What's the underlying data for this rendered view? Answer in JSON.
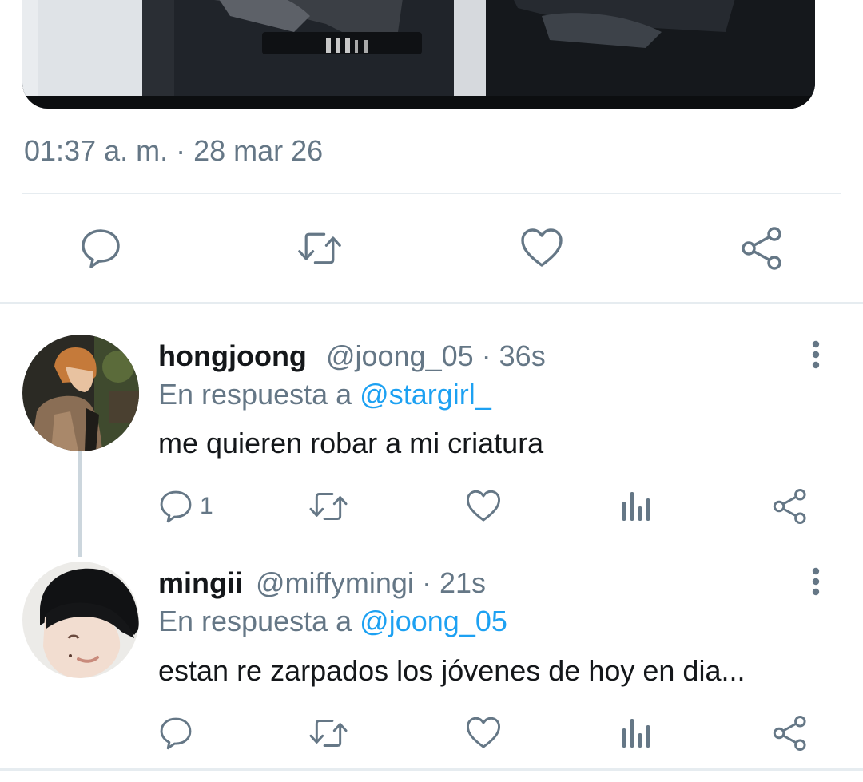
{
  "colors": {
    "text_primary": "#14171a",
    "text_secondary": "#657786",
    "link": "#1da1f2",
    "icon": "#657786",
    "divider": "#e6ecf0",
    "thread_line": "#ccd6dd"
  },
  "tweet": {
    "media": "photo",
    "timestamp": "01:37 a. m. · 28 mar 26",
    "actions": [
      {
        "icon": "reply-icon"
      },
      {
        "icon": "retweet-icon"
      },
      {
        "icon": "like-icon"
      },
      {
        "icon": "share-icon"
      }
    ]
  },
  "replies": [
    {
      "avatar": "hongjoong-avatar",
      "display_name": "hongjoong",
      "handle": "@joong_05",
      "time": "· 36s",
      "replying_prefix": "En respuesta a",
      "replying_to": "@stargirl_",
      "text": "me quieren robar a mi criatura",
      "reply_count": "1",
      "actions": [
        "reply-icon",
        "retweet-icon",
        "like-icon",
        "analytics-icon",
        "share-icon"
      ]
    },
    {
      "avatar": "mingii-avatar",
      "display_name": "mingii",
      "handle": "@miffymingi",
      "time": "· 21s",
      "replying_prefix": "En respuesta a",
      "replying_to": "@joong_05",
      "text": "estan re zarpados los jóvenes de hoy en dia...",
      "reply_count": "",
      "actions": [
        "reply-icon",
        "retweet-icon",
        "like-icon",
        "analytics-icon",
        "share-icon"
      ]
    }
  ]
}
